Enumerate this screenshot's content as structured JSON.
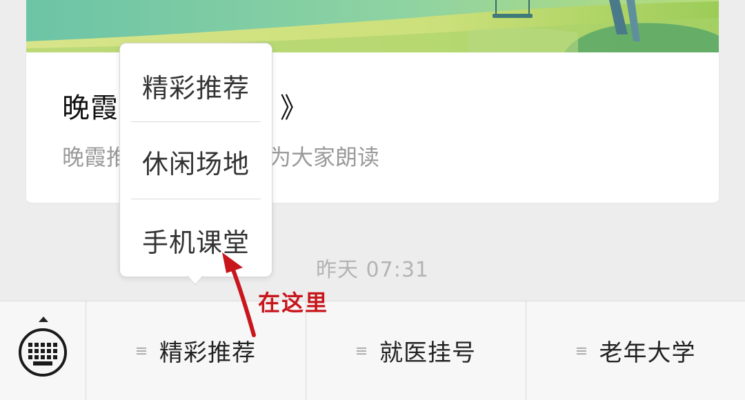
{
  "article": {
    "title_visible": "晚霞",
    "title_tail": "》",
    "digest_visible": "晚霞推",
    "digest_tail": "为大家朗读"
  },
  "timestamp": "昨天 07:31",
  "popup_menu": {
    "items": [
      {
        "label": "精彩推荐"
      },
      {
        "label": "休闲场地"
      },
      {
        "label": "手机课堂"
      }
    ]
  },
  "bottom_menu": {
    "items": [
      {
        "label": "精彩推荐"
      },
      {
        "label": "就医挂号"
      },
      {
        "label": "老年大学"
      }
    ]
  },
  "annotation": {
    "text": "在这里",
    "color": "#c8161d"
  },
  "icons": {
    "keyboard": "keyboard-icon",
    "submenu": "submenu-lines-icon"
  }
}
